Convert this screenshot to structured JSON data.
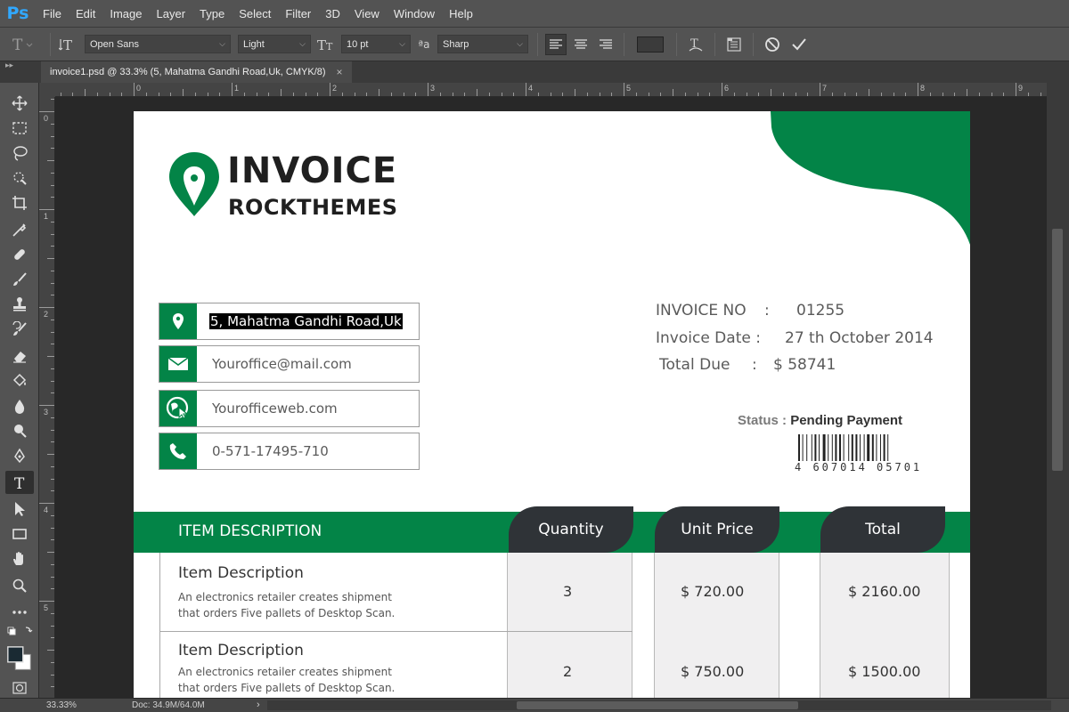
{
  "app": {
    "logo": "Ps",
    "accent": "#31a8ff"
  },
  "menu": [
    "File",
    "Edit",
    "Image",
    "Layer",
    "Type",
    "Select",
    "Filter",
    "3D",
    "View",
    "Window",
    "Help"
  ],
  "options": {
    "font_family": "Open Sans",
    "font_style": "Light",
    "font_size": "10 pt",
    "antialias_icon": "ªa",
    "antialias": "Sharp"
  },
  "tab": {
    "title": "invoice1.psd @ 33.3% (5, Mahatma Gandhi Road,Uk, CMYK/8)",
    "close": "×"
  },
  "ruler": {
    "top": [
      "0",
      "1",
      "2",
      "3",
      "4",
      "5",
      "6",
      "7",
      "8",
      "9"
    ],
    "left": [
      "0",
      "1",
      "2",
      "3",
      "4",
      "5"
    ]
  },
  "invoice": {
    "brand_color": "#038447",
    "title": "INVOICE",
    "subtitle": "ROCKTHEMES",
    "address": "5, Mahatma Gandhi Road,Uk",
    "email": "Youroffice@mail.com",
    "web": "Yourofficeweb.com",
    "phone": "0-571-17495-710",
    "invoice_no_label": "INVOICE NO",
    "invoice_no_sep": ":",
    "invoice_no": "01255",
    "date_label": "Invoice Date :",
    "date": "27 th October 2014",
    "total_due_label": "Total Due",
    "total_due_sep": ":",
    "total_due": "$ 58741",
    "status_label": "Status :",
    "status_value": "Pending Payment",
    "barcode_number": "4 607014 05701",
    "headers": {
      "description": "ITEM DESCRIPTION",
      "quantity": "Quantity",
      "unit_price": "Unit Price",
      "total": "Total"
    },
    "items": [
      {
        "title": "Item Description",
        "desc": "An electronics retailer creates shipment that orders Five pallets of Desktop Scan.",
        "qty": "3",
        "price": "$ 720.00",
        "total": "$ 2160.00"
      },
      {
        "title": "Item Description",
        "desc": "An electronics retailer creates shipment that orders Five pallets of Desktop Scan.",
        "qty": "2",
        "price": "$ 750.00",
        "total": "$ 1500.00"
      }
    ]
  },
  "status_bar": {
    "zoom": "33.33%",
    "doc": "Doc: 34.9M/64.0M",
    "arrow": "›"
  },
  "icons": [
    "move-icon",
    "marquee-icon",
    "lasso-icon",
    "quick-select-icon",
    "crop-icon",
    "eyedropper-icon",
    "healing-icon",
    "brush-icon",
    "stamp-icon",
    "history-brush-icon",
    "eraser-icon",
    "paint-bucket-icon",
    "blur-icon",
    "dodge-icon",
    "pen-icon",
    "type-icon",
    "path-select-icon",
    "rectangle-icon",
    "hand-icon",
    "zoom-icon",
    "more-tools-icon"
  ]
}
